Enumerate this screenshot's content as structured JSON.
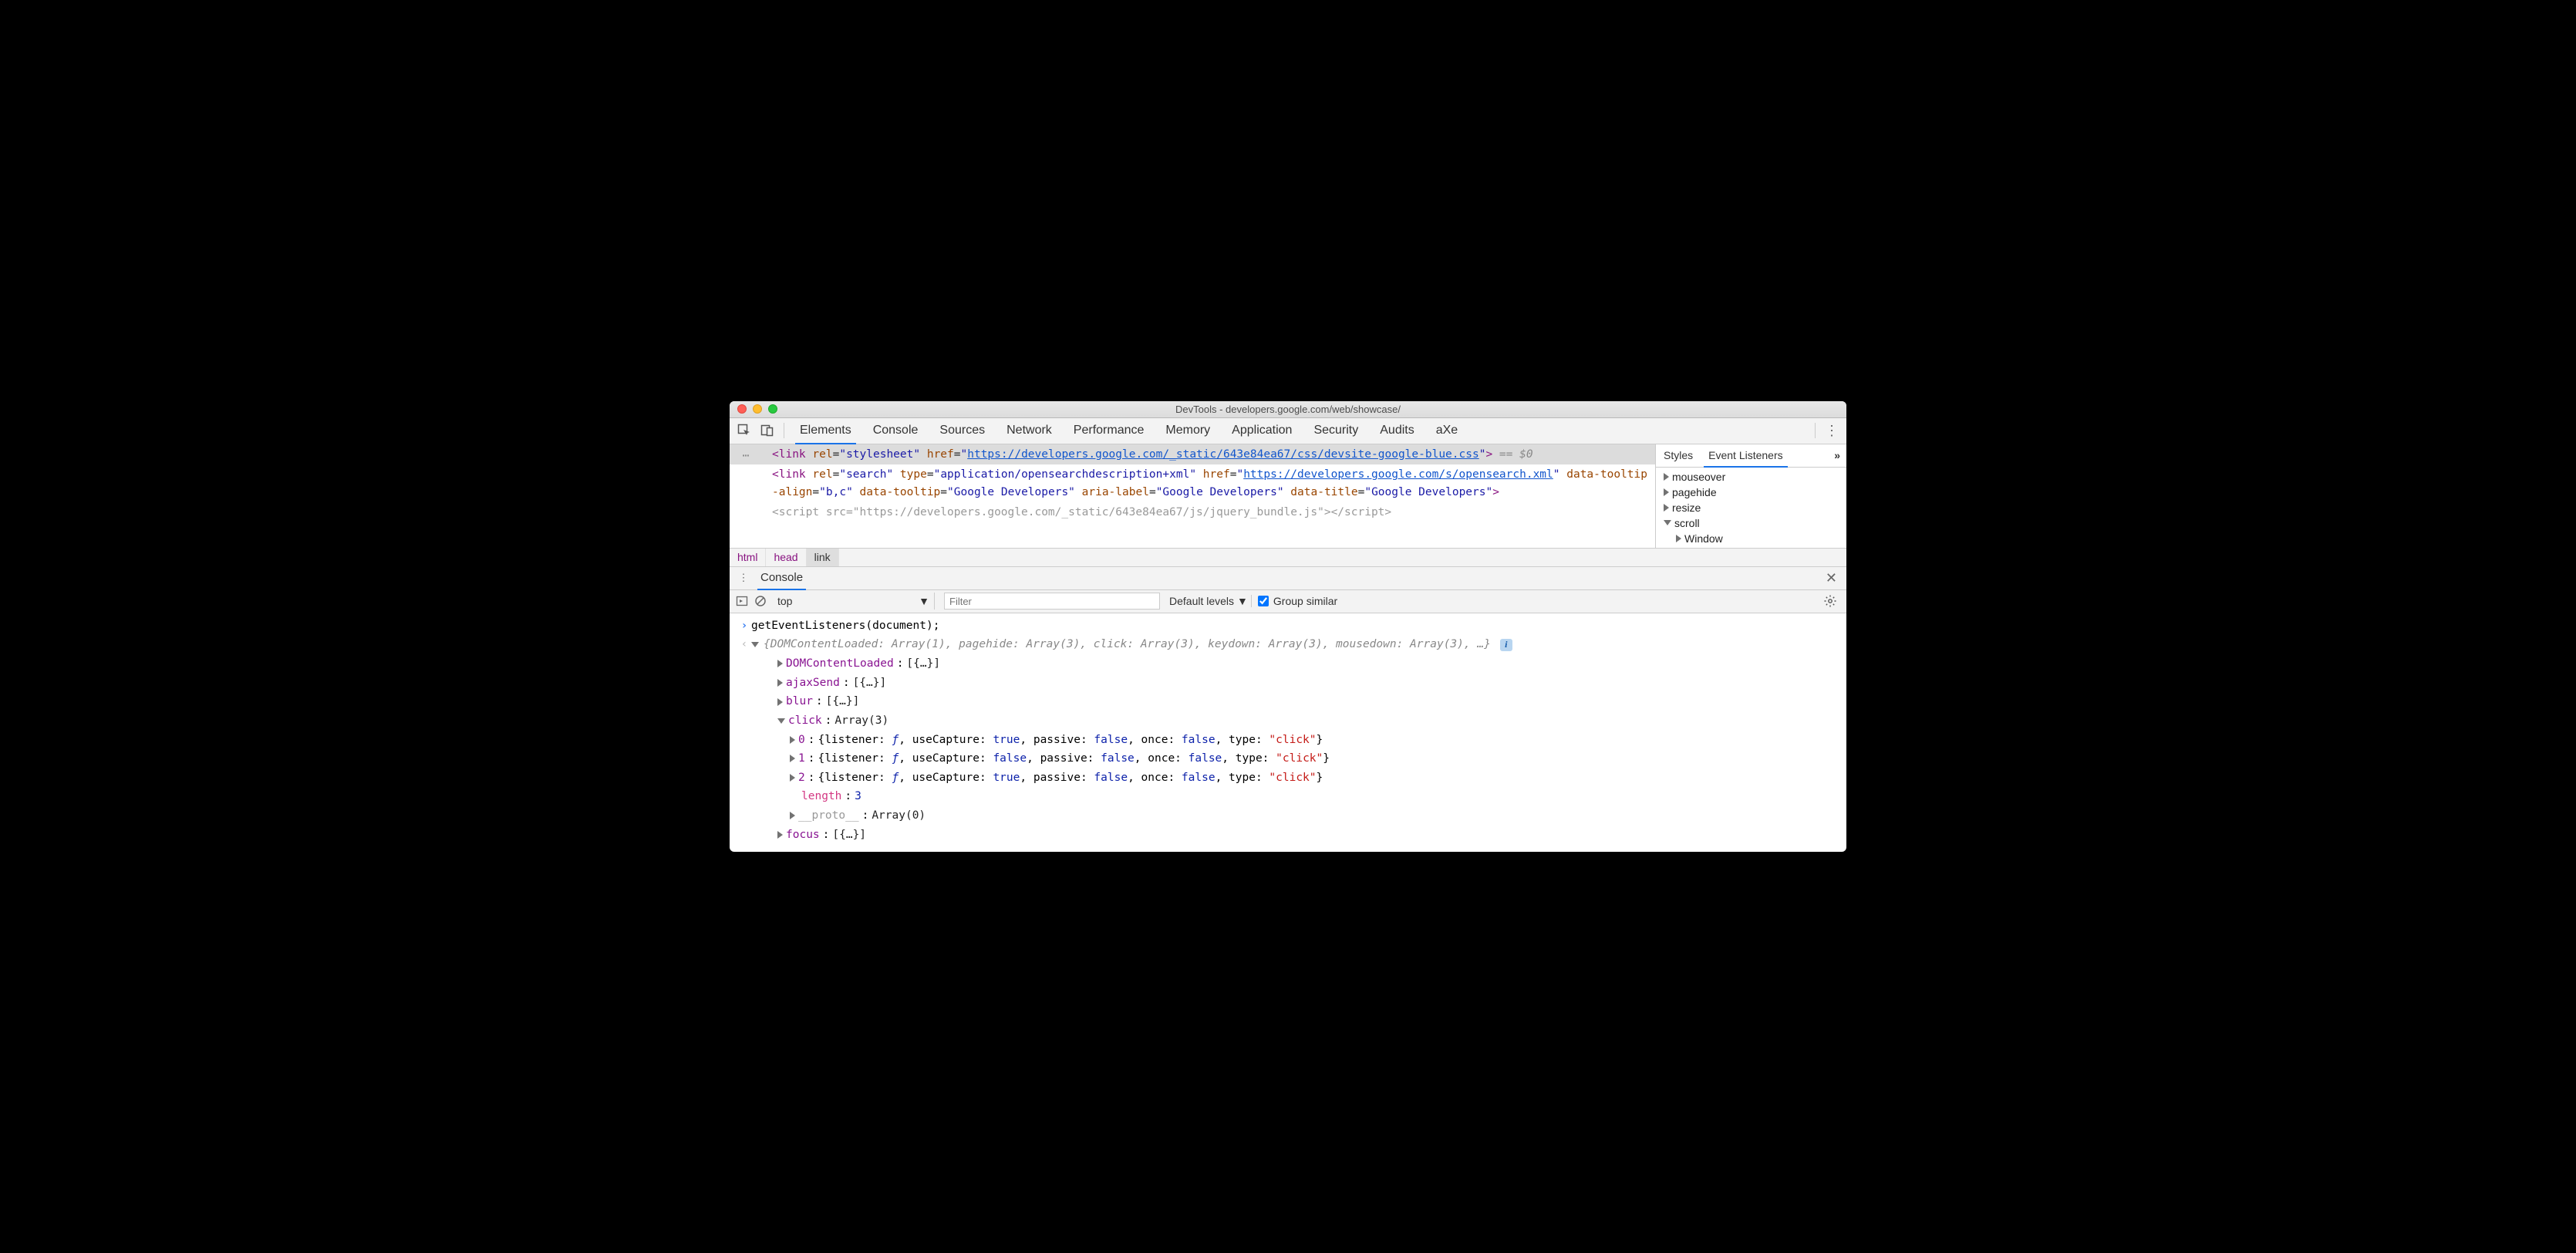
{
  "window": {
    "title": "DevTools - developers.google.com/web/showcase/"
  },
  "tabs": {
    "items": [
      "Elements",
      "Console",
      "Sources",
      "Network",
      "Performance",
      "Memory",
      "Application",
      "Security",
      "Audits",
      "aXe"
    ],
    "active": "Elements"
  },
  "dom": {
    "line1": {
      "pre": "<link ",
      "rel": "stylesheet",
      "href": "https://developers.google.com/_static/643e84ea67/css/devsite-google-blue.css",
      "post": "> == $0"
    },
    "line2": {
      "pre": "<link ",
      "rel": "search",
      "type": "application/opensearchdescription+xml",
      "href": "https://developers.google.com/s/opensearch.xml",
      "tooltipAlign": "b,c",
      "tooltip": "Google Developers",
      "aria": "Google Developers",
      "title": "Google Developers"
    },
    "line3_partial": "<script src=\"https://developers.google.com/_static/643e84ea67/js/jquery_bundle.js\"></script>"
  },
  "crumbs": [
    "html",
    "head",
    "link"
  ],
  "sidebar": {
    "tabs": [
      "Styles",
      "Event Listeners"
    ],
    "active": "Event Listeners",
    "events": [
      {
        "name": "mouseover",
        "exp": false
      },
      {
        "name": "pagehide",
        "exp": false
      },
      {
        "name": "resize",
        "exp": false
      },
      {
        "name": "scroll",
        "exp": true,
        "child": "Window"
      }
    ]
  },
  "drawer": {
    "tab": "Console"
  },
  "consoleToolbar": {
    "context": "top",
    "filterPlaceholder": "Filter",
    "levels": "Default levels",
    "groupSimilar": "Group similar"
  },
  "console": {
    "input": "getEventListeners(document);",
    "summary": "{DOMContentLoaded: Array(1), pagehide: Array(3), click: Array(3), keydown: Array(3), mousedown: Array(3), …}",
    "rows": [
      {
        "k": "DOMContentLoaded",
        "v": "[{…}]",
        "d": 1,
        "exp": false
      },
      {
        "k": "ajaxSend",
        "v": "[{…}]",
        "d": 1,
        "exp": false
      },
      {
        "k": "blur",
        "v": "[{…}]",
        "d": 1,
        "exp": false
      },
      {
        "k": "click",
        "v": "Array(3)",
        "d": 1,
        "exp": true
      }
    ],
    "click_items": [
      {
        "idx": "0",
        "useCapture": "true",
        "passive": "false",
        "once": "false",
        "type": "click"
      },
      {
        "idx": "1",
        "useCapture": "false",
        "passive": "false",
        "once": "false",
        "type": "click"
      },
      {
        "idx": "2",
        "useCapture": "true",
        "passive": "false",
        "once": "false",
        "type": "click"
      }
    ],
    "length": "3",
    "proto": "Array(0)",
    "tail": {
      "k": "focus",
      "v": "[{…}]"
    }
  }
}
